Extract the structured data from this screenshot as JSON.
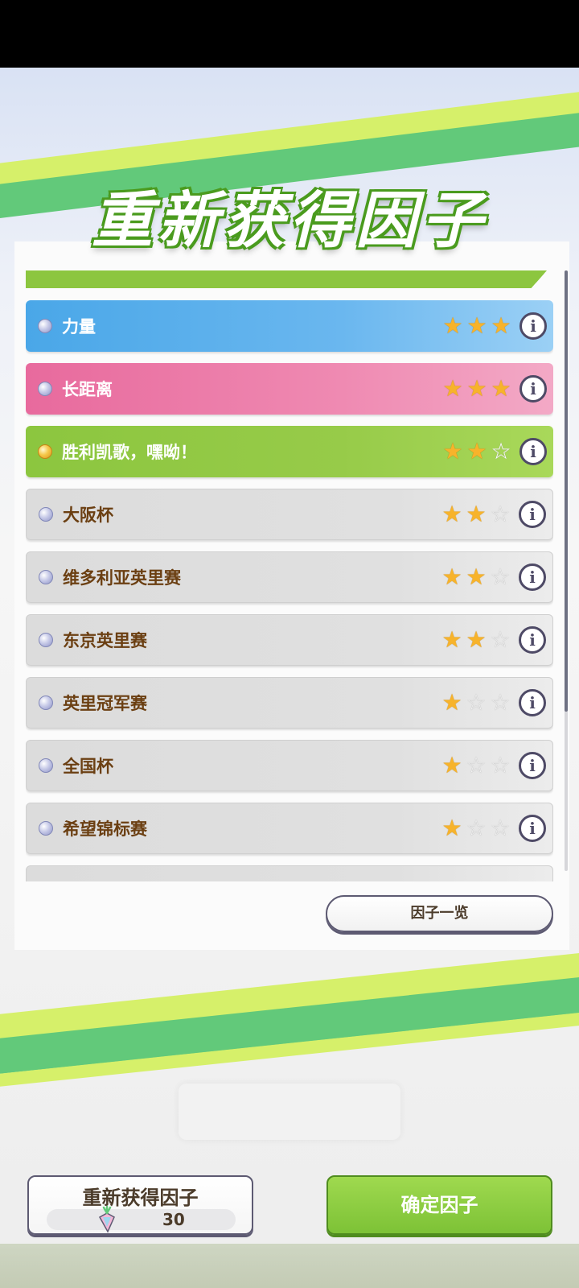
{
  "title": "重新获得因子",
  "factors": [
    {
      "name": "力量",
      "stars": 3,
      "color": "blue",
      "bullet": "silver"
    },
    {
      "name": "长距离",
      "stars": 3,
      "color": "pink",
      "bullet": "silver"
    },
    {
      "name": "胜利凯歌，嘿呦！",
      "stars": 2,
      "color": "green",
      "bullet": "gold"
    },
    {
      "name": "大阪杯",
      "stars": 2,
      "color": "gray",
      "bullet": "silver"
    },
    {
      "name": "维多利亚英里赛",
      "stars": 2,
      "color": "gray",
      "bullet": "silver"
    },
    {
      "name": "东京英里赛",
      "stars": 2,
      "color": "gray",
      "bullet": "silver"
    },
    {
      "name": "英里冠军赛",
      "stars": 1,
      "color": "gray",
      "bullet": "silver"
    },
    {
      "name": "全国杯",
      "stars": 1,
      "color": "gray",
      "bullet": "silver"
    },
    {
      "name": "希望锦标赛",
      "stars": 1,
      "color": "gray",
      "bullet": "silver"
    }
  ],
  "factor_list_button": "因子一览",
  "reacquire_button": {
    "label": "重新获得因子",
    "cost": "30",
    "icon": "carrot-icon"
  },
  "confirm_button": "确定因子",
  "colors": {
    "blue": "#4aa7e8",
    "pink": "#e86a9d",
    "green": "#8cc63f",
    "gray": "#dcdcdc",
    "star": "#f7b32b"
  }
}
